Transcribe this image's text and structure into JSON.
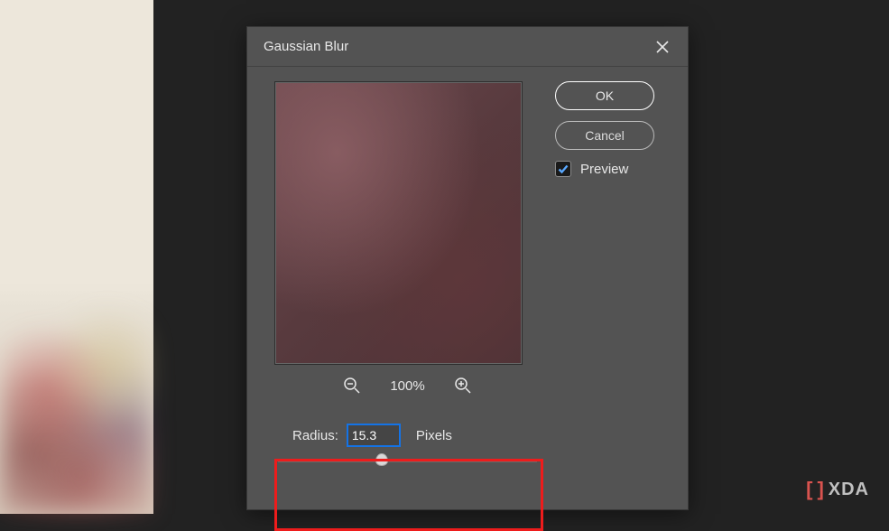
{
  "dialog": {
    "title": "Gaussian Blur",
    "zoom_percent": "100%",
    "radius_label": "Radius:",
    "radius_value": "15.3",
    "radius_unit": "Pixels"
  },
  "buttons": {
    "ok": "OK",
    "cancel": "Cancel"
  },
  "preview_checkbox": {
    "label": "Preview",
    "checked": true
  },
  "watermark": {
    "text": "XDA"
  }
}
